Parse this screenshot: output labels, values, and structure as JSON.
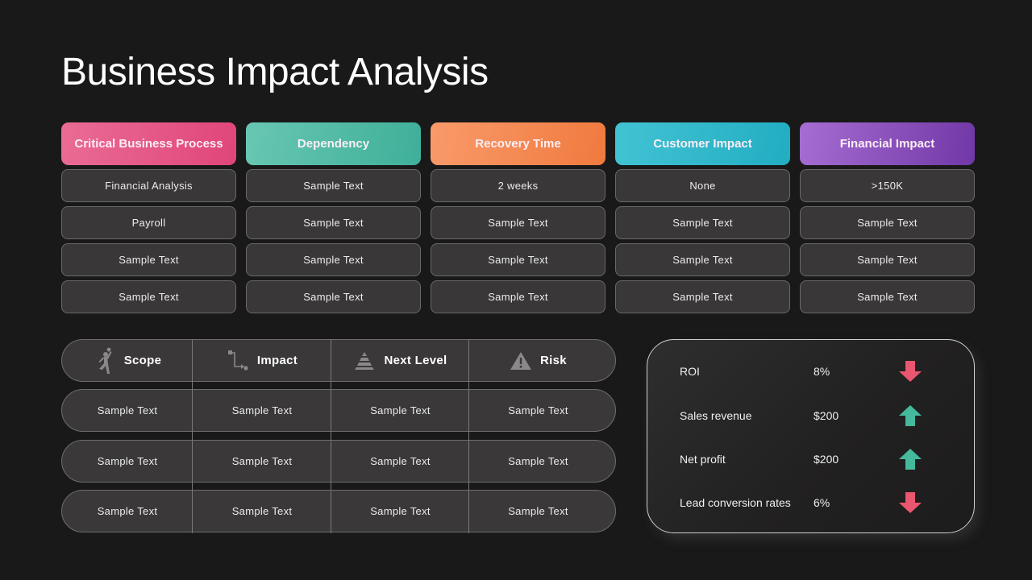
{
  "title": "Business Impact Analysis",
  "top_table": {
    "columns": [
      {
        "header": "Critical Business Process",
        "color_from": "#ea6c95",
        "color_to": "#e0457a",
        "cells": [
          "Financial Analysis",
          "Payroll",
          "Sample Text",
          "Sample Text"
        ]
      },
      {
        "header": "Dependency",
        "color_from": "#68c7b2",
        "color_to": "#3faf99",
        "cells": [
          "Sample Text",
          "Sample Text",
          "Sample Text",
          "Sample Text"
        ]
      },
      {
        "header": "Recovery Time",
        "color_from": "#f99a6a",
        "color_to": "#f07a3e",
        "cells": [
          "2 weeks",
          "Sample Text",
          "Sample Text",
          "Sample Text"
        ]
      },
      {
        "header": "Customer Impact",
        "color_from": "#42c3d3",
        "color_to": "#22adc2",
        "cells": [
          "None",
          "Sample Text",
          "Sample Text",
          "Sample Text"
        ]
      },
      {
        "header": "Financial Impact",
        "color_from": "#a66dd2",
        "color_to": "#7137a6",
        "cells": [
          ">150K",
          "Sample Text",
          "Sample Text",
          "Sample Text"
        ]
      }
    ]
  },
  "bottom_table": {
    "headers": [
      {
        "label": "Scope",
        "icon": "running-person-icon"
      },
      {
        "label": "Impact",
        "icon": "flow-path-icon"
      },
      {
        "label": "Next Level",
        "icon": "pyramid-icon"
      },
      {
        "label": "Risk",
        "icon": "warning-icon"
      }
    ],
    "rows": [
      [
        "Sample Text",
        "Sample Text",
        "Sample Text",
        "Sample Text"
      ],
      [
        "Sample Text",
        "Sample Text",
        "Sample Text",
        "Sample Text"
      ],
      [
        "Sample Text",
        "Sample Text",
        "Sample Text",
        "Sample Text"
      ]
    ]
  },
  "kpis": [
    {
      "label": "ROI",
      "value": "8%",
      "trend": "down"
    },
    {
      "label": "Sales revenue",
      "value": "$200",
      "trend": "up"
    },
    {
      "label": "Net profit",
      "value": "$200",
      "trend": "up"
    },
    {
      "label": "Lead conversion rates",
      "value": "6%",
      "trend": "down"
    }
  ],
  "colors": {
    "trend_up": "#45b99c",
    "trend_down": "#e8566f",
    "icon_gray": "#8a8888"
  }
}
